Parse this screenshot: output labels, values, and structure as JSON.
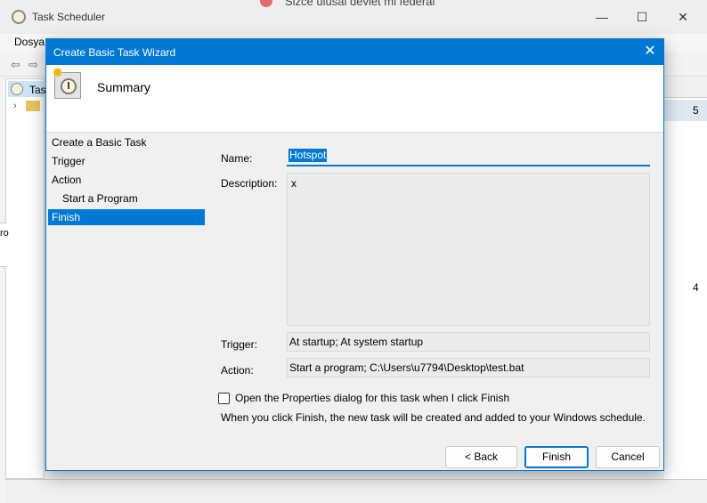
{
  "background": {
    "window_title": "Task Scheduler",
    "tab_text": "Sizce ulusal devlet mi federal",
    "menu_item": "Dosya",
    "window_controls": {
      "minimize": "—",
      "maximize": "☐",
      "close": "✕"
    },
    "tree_first_item": "Tas",
    "right_pane_values": [
      "5",
      "4"
    ],
    "left_strip_text": "ro"
  },
  "dialog": {
    "title": "Create Basic Task Wizard",
    "close_glyph": "✕",
    "header_title": "Summary",
    "nav": [
      {
        "label": "Create a Basic Task"
      },
      {
        "label": "Trigger"
      },
      {
        "label": "Action"
      },
      {
        "label": "Start a Program"
      },
      {
        "label": "Finish"
      }
    ],
    "fields": {
      "name_label": "Name:",
      "name_value": "Hotspot",
      "description_label": "Description:",
      "description_value": "x",
      "trigger_label": "Trigger:",
      "trigger_value": "At startup; At system startup",
      "action_label": "Action:",
      "action_value": "Start a program; C:\\Users\\u7794\\Desktop\\test.bat"
    },
    "open_properties_label": "Open the Properties dialog for this task when I click Finish",
    "open_properties_checked": false,
    "info_text": "When you click Finish, the new task will be created and added to your Windows schedule.",
    "buttons": {
      "back": "< Back",
      "finish": "Finish",
      "cancel": "Cancel"
    },
    "accent_color": "#0078d4"
  }
}
